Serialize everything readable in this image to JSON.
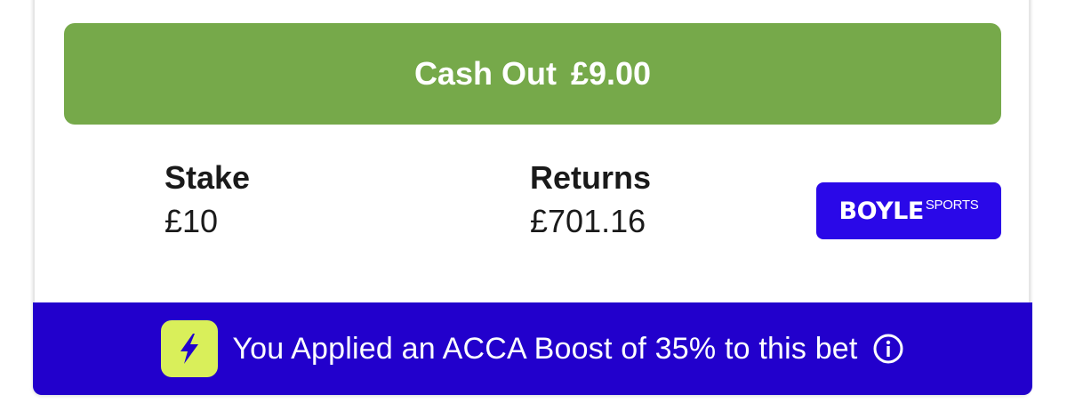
{
  "cash_out": {
    "label": "Cash Out",
    "amount": "£9.00"
  },
  "bet_info": {
    "stake_label": "Stake",
    "stake_value": "£10",
    "returns_label": "Returns",
    "returns_value": "£701.16"
  },
  "bookmaker": {
    "logo_main": "BOYLE",
    "logo_sub": "SPORTS",
    "brand_color": "#2a08e8"
  },
  "boost_banner": {
    "text": "You Applied an ACCA Boost of 35% to this bet",
    "icon": "lightning-bolt-icon",
    "info_icon": "info-icon",
    "background_color": "#2200cc",
    "icon_color": "#d9ef5a"
  },
  "colors": {
    "cash_out_green": "#76a94a"
  }
}
